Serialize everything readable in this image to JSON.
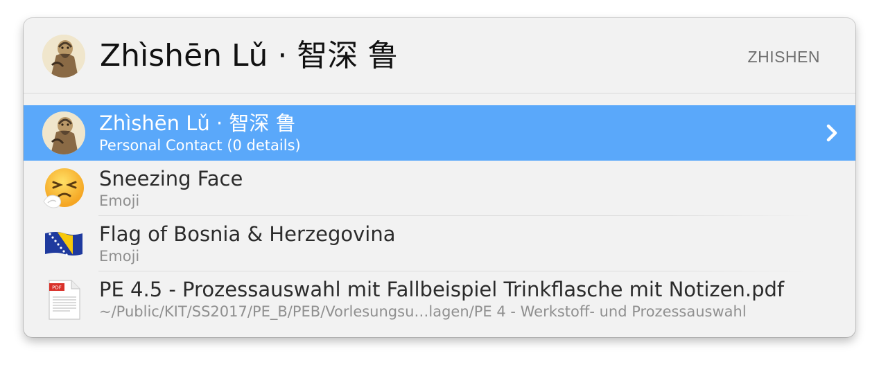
{
  "header": {
    "query": "Zhìshēn Lǔ · 智深 鲁",
    "shortcut_hint": "ZHISHEN"
  },
  "results": [
    {
      "title": "Zhìshēn Lǔ · 智深 鲁",
      "subtitle": "Personal Contact (0 details)",
      "icon": "contact-avatar-icon",
      "selected": true
    },
    {
      "title": "Sneezing Face",
      "subtitle": "Emoji",
      "icon": "sneezing-face-emoji-icon",
      "selected": false
    },
    {
      "title": "Flag of Bosnia & Herzegovina",
      "subtitle": "Emoji",
      "icon": "bosnia-flag-emoji-icon",
      "selected": false
    },
    {
      "title": "PE 4.5 - Prozessauswahl mit Fallbeispiel Trinkflasche mit Notizen.pdf",
      "subtitle": "~/Public/KIT/SS2017/PE_B/PEB/Vorlesungsu…lagen/PE 4 - Werkstoff- und Prozessauswahl",
      "icon": "pdf-file-icon",
      "selected": false
    }
  ],
  "colors": {
    "selection": "#5aa8fa",
    "panel_background": "#f2f2f2",
    "title_text": "#2b2b2b",
    "subtitle_text": "#8f8f8f"
  }
}
